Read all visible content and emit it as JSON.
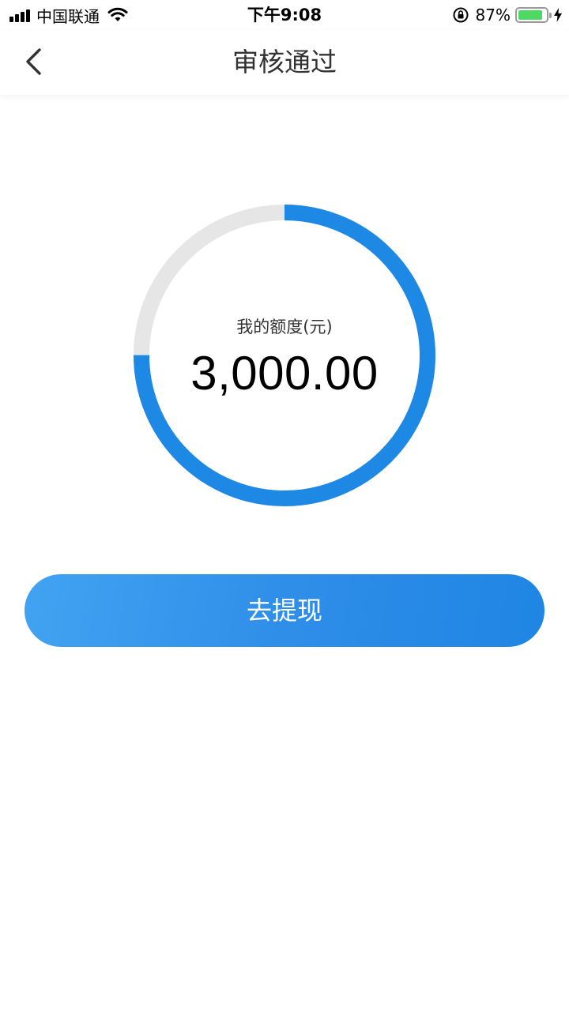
{
  "status_bar": {
    "carrier": "中国联通",
    "time": "下午9:08",
    "battery_percent": "87%",
    "battery_level": 0.87
  },
  "nav": {
    "title": "审核通过",
    "back_icon": "chevron-left-icon"
  },
  "credit": {
    "label": "我的额度(元)",
    "amount": "3,000.00",
    "ring_progress": 0.75,
    "ring_color": "#1e88e5",
    "ring_track_color": "#e6e6e6"
  },
  "action": {
    "withdraw_label": "去提现"
  }
}
